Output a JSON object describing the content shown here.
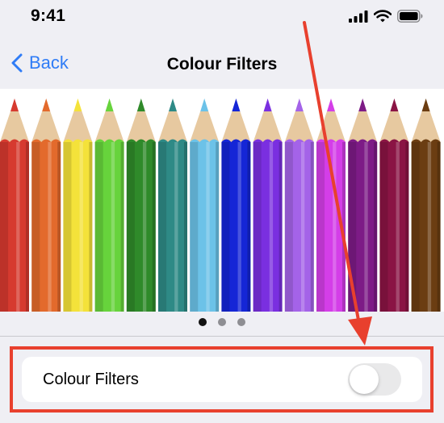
{
  "status_bar": {
    "time": "9:41",
    "icons": [
      "cellular-signal-icon",
      "wifi-icon",
      "battery-icon"
    ]
  },
  "nav": {
    "back_label": "Back",
    "back_icon": "chevron-left-icon",
    "title": "Colour Filters"
  },
  "carousel": {
    "pencil_colors": [
      "#d63a2f",
      "#e36a2c",
      "#f4e23a",
      "#67d33c",
      "#2f8a2a",
      "#2e8a86",
      "#6cc2e8",
      "#1526d6",
      "#7a2fe0",
      "#a463e8",
      "#d43ee8",
      "#7d1b86",
      "#8a1444",
      "#6b3d12"
    ],
    "page_count": 3,
    "active_page": 1
  },
  "settings": {
    "colour_filters_label": "Colour Filters",
    "colour_filters_enabled": false
  },
  "colors": {
    "accent": "#2f7cf6",
    "annotation": "#e8402e",
    "background": "#efeff4",
    "toggle_off": "#e9e9ea"
  }
}
